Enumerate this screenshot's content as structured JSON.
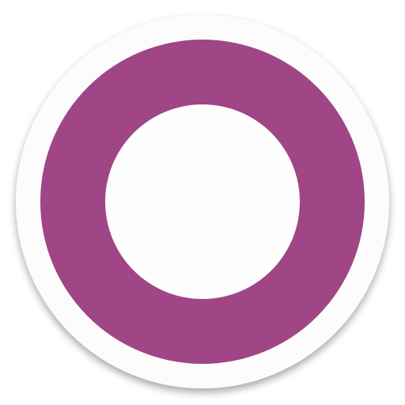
{
  "icon": {
    "name": "purple-ring-app-icon",
    "colors": {
      "background_disc": "#FCFCFC",
      "ring": "#A04585",
      "center": "#FEFEFE",
      "shadow": "#9E9E9E"
    }
  }
}
